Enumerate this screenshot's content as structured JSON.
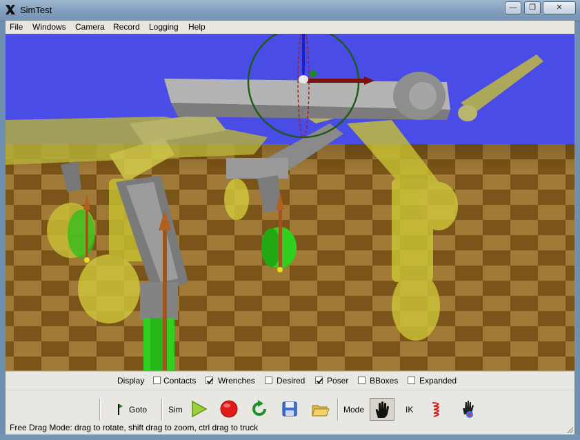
{
  "window": {
    "title": "SimTest",
    "min_glyph": "—",
    "max_glyph": "❐",
    "close_glyph": "✕",
    "icon": "x11-icon"
  },
  "menu": {
    "items": [
      "File",
      "Windows",
      "Camera",
      "Record",
      "Logging",
      "Help"
    ]
  },
  "display": {
    "label": "Display",
    "options": [
      {
        "label": "Contacts",
        "checked": false
      },
      {
        "label": "Wrenches",
        "checked": true
      },
      {
        "label": "Desired",
        "checked": false
      },
      {
        "label": "Poser",
        "checked": true
      },
      {
        "label": "BBoxes",
        "checked": false
      },
      {
        "label": "Expanded",
        "checked": false
      }
    ]
  },
  "toolbar": {
    "goto_label": "Goto",
    "sim_label": "Sim",
    "mode_label": "Mode",
    "ik_label": "IK",
    "icons": {
      "goto": "flag-icon",
      "play": "play-icon",
      "record": "record-icon",
      "reset": "reset-icon",
      "save": "save-icon",
      "open": "open-folder-icon",
      "free_drag": "hand-icon",
      "spring": "spring-icon",
      "force": "force-hand-icon"
    }
  },
  "status": {
    "text": "Free Drag Mode: drag to rotate, shift drag to zoom, ctrl drag to truck"
  },
  "colors": {
    "sky": "#4a4ce6",
    "floor_light": "#a07a36",
    "floor_dark": "#7a5418",
    "robot_body": "#8c8c8c",
    "robot_ghost": "#c8c232",
    "wheel_green": "#2fd01d",
    "wrench_arrow": "#a0551c"
  }
}
